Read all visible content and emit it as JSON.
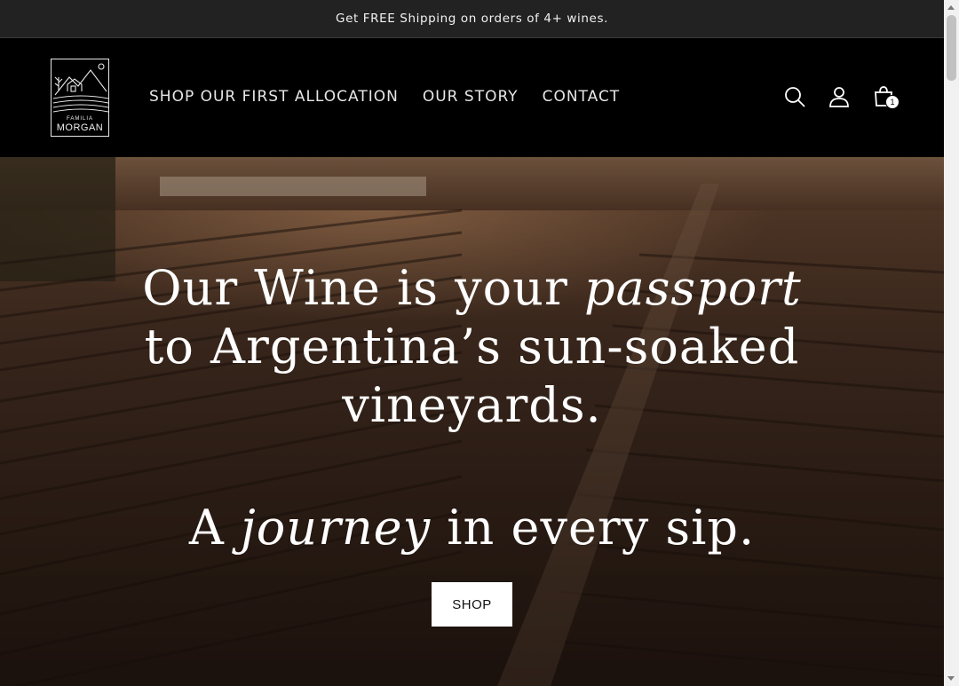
{
  "announcement": {
    "text": "Get FREE Shipping on orders of 4+ wines."
  },
  "brand": {
    "line1": "FAMILIA",
    "line2": "MORGAN"
  },
  "nav": {
    "items": [
      {
        "label": "SHOP OUR FIRST ALLOCATION"
      },
      {
        "label": "OUR STORY"
      },
      {
        "label": "CONTACT"
      }
    ]
  },
  "header_icons": {
    "search": "search-icon",
    "account": "account-icon",
    "cart": "cart-icon",
    "cart_count": "1"
  },
  "hero": {
    "line1_a": "Our Wine is your ",
    "line1_em": "passport",
    "line2": "to Argentina’s sun-soaked",
    "line3": "vineyards.",
    "tag_a": "A ",
    "tag_em": "journey",
    "tag_b": " in every sip.",
    "cta_label": "SHOP"
  },
  "colors": {
    "announce_bg": "#222222",
    "header_bg": "#000000",
    "text_light": "#ffffff"
  }
}
